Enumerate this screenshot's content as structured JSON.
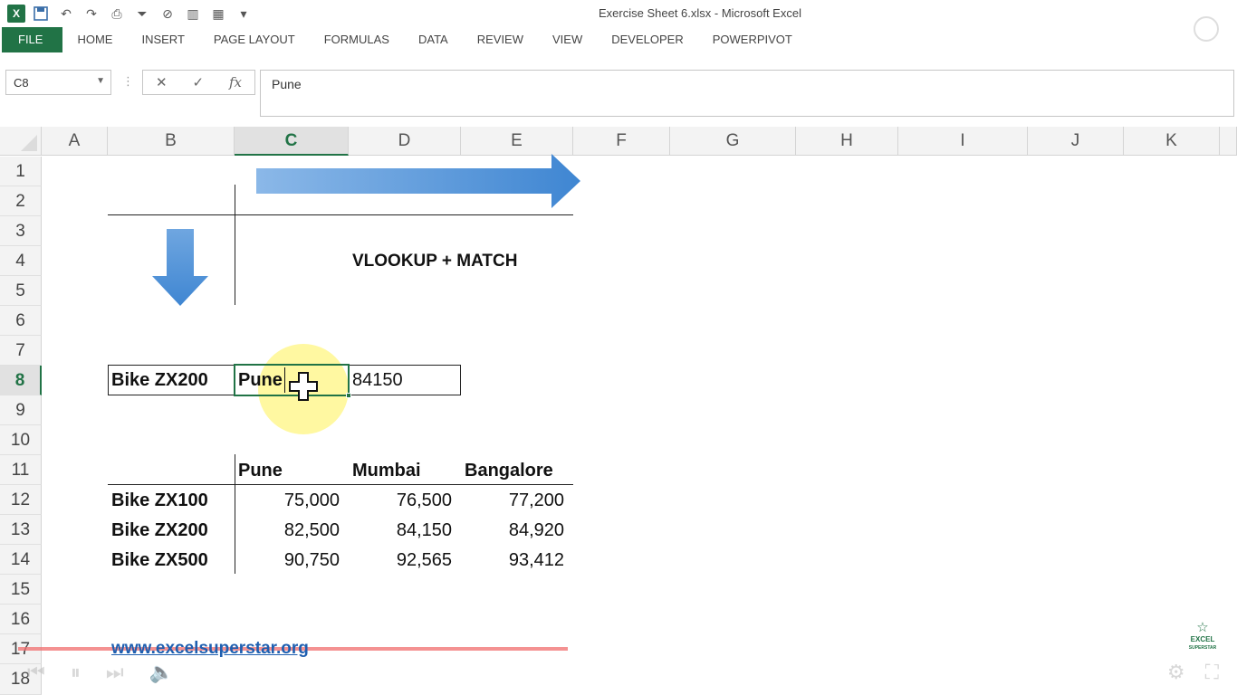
{
  "window": {
    "title": "Exercise Sheet 6.xlsx - Microsoft Excel"
  },
  "ribbon": {
    "tabs": [
      "FILE",
      "HOME",
      "INSERT",
      "PAGE LAYOUT",
      "FORMULAS",
      "DATA",
      "REVIEW",
      "VIEW",
      "DEVELOPER",
      "POWERPIVOT"
    ]
  },
  "formula_bar": {
    "name_box": "C8",
    "content": "Pune",
    "fx": "fx"
  },
  "columns": [
    "A",
    "B",
    "C",
    "D",
    "E",
    "F",
    "G",
    "H",
    "I",
    "J",
    "K"
  ],
  "rows": [
    "1",
    "2",
    "3",
    "4",
    "5",
    "6",
    "7",
    "8",
    "9",
    "10",
    "11",
    "12",
    "13",
    "14",
    "15",
    "16",
    "17",
    "18"
  ],
  "selected": {
    "column": "C",
    "row": "8"
  },
  "sheet": {
    "heading": "VLOOKUP + MATCH",
    "lookup": {
      "item": "Bike ZX200",
      "city": "Pune",
      "result": "84150"
    },
    "table": {
      "headers": [
        "Pune",
        "Mumbai",
        "Bangalore"
      ],
      "rows": [
        {
          "label": "Bike ZX100",
          "values": [
            "75,000",
            "76,500",
            "77,200"
          ]
        },
        {
          "label": "Bike ZX200",
          "values": [
            "82,500",
            "84,150",
            "84,920"
          ]
        },
        {
          "label": "Bike ZX500",
          "values": [
            "90,750",
            "92,565",
            "93,412"
          ]
        }
      ]
    },
    "link": "www.excelsuperstar.org"
  },
  "watermark": {
    "line1": "EXCEL",
    "line2": "SUPERSTAR"
  },
  "colors": {
    "excel_green": "#217346",
    "arrow_blue": "#4a8fd6",
    "highlight": "#fff582",
    "link": "#1f5fb0"
  }
}
